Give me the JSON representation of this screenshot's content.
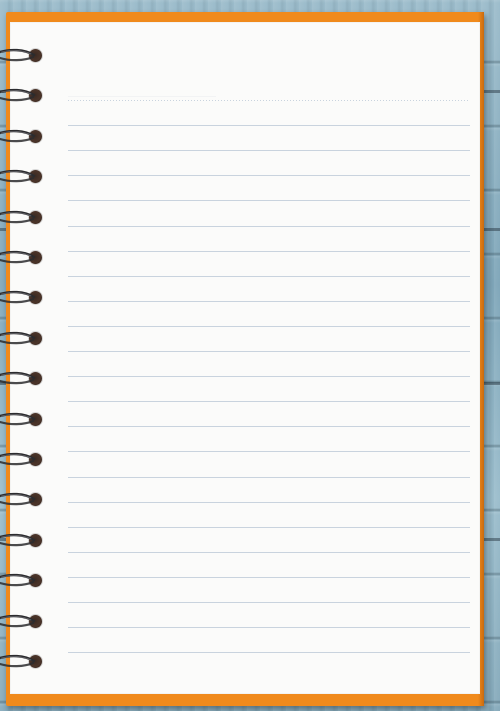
{
  "image": {
    "subject": "spiral notebook",
    "colors": {
      "cover": "#f08a1c",
      "paper": "#fbfbfa",
      "ruled_line": "#c9d3de",
      "wood": "#8fb3c4",
      "wire": "#2b2b2e",
      "hole": "#3a2a22"
    },
    "ruled_line_count": 23,
    "spiral_ring_count": 16
  }
}
